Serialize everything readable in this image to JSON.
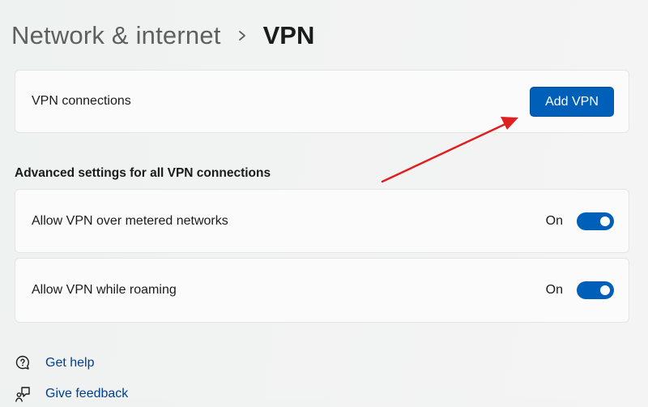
{
  "header": {
    "parent": "Network & internet",
    "separator_icon": "chevron-right-icon",
    "current": "VPN"
  },
  "vpn_connections": {
    "label": "VPN connections",
    "add_button_label": "Add VPN"
  },
  "advanced": {
    "title": "Advanced settings for all VPN connections",
    "settings": [
      {
        "label": "Allow VPN over metered networks",
        "state": "On",
        "enabled": true
      },
      {
        "label": "Allow VPN while roaming",
        "state": "On",
        "enabled": true
      }
    ]
  },
  "links": {
    "help": {
      "label": "Get help",
      "icon": "help-chat-icon"
    },
    "feedback": {
      "label": "Give feedback",
      "icon": "feedback-icon"
    }
  },
  "annotation": {
    "icon": "red-arrow-icon",
    "color": "#e02020"
  },
  "colors": {
    "accent": "#005fb8",
    "link": "#003e92",
    "card_background": "#fbfbfb"
  }
}
